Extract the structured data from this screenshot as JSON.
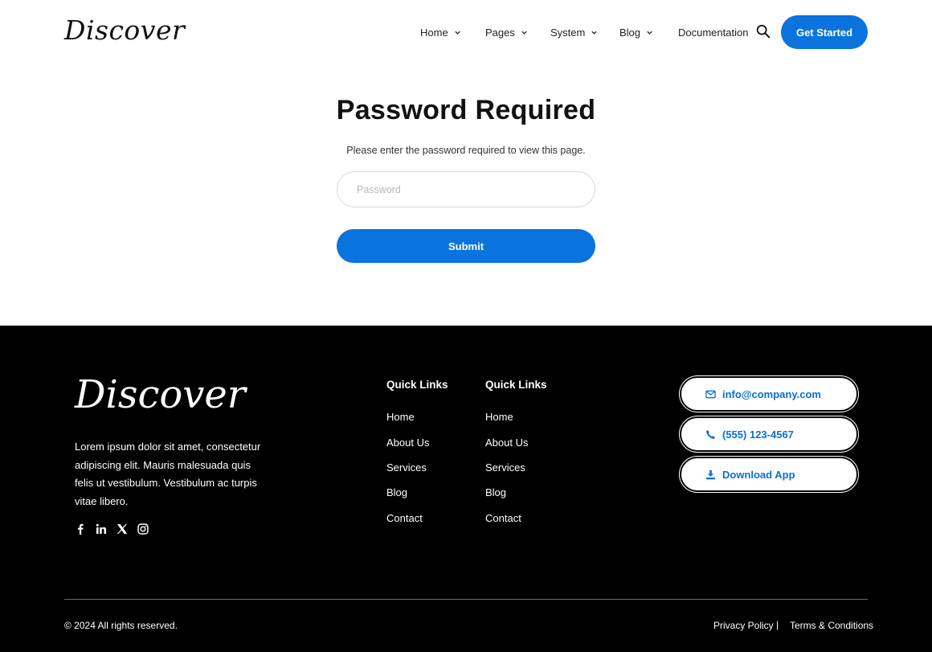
{
  "header": {
    "logo": "Discover",
    "nav": [
      {
        "label": "Home",
        "has_dropdown": true
      },
      {
        "label": "Pages",
        "has_dropdown": true
      },
      {
        "label": "System",
        "has_dropdown": true
      },
      {
        "label": "Blog",
        "has_dropdown": true
      },
      {
        "label": "Documentation",
        "has_dropdown": false
      }
    ],
    "search_icon": "search-icon",
    "cta_label": "Get Started"
  },
  "main": {
    "title": "Password Required",
    "description": "Please enter the password required to view this page.",
    "password_placeholder": "Password",
    "password_value": "",
    "submit_label": "Submit"
  },
  "footer": {
    "logo": "Discover",
    "description": "Lorem ipsum dolor sit amet, consectetur adipiscing elit. Mauris malesuada quis felis ut vestibulum. Vestibulum ac turpis vitae libero.",
    "social": [
      "facebook-icon",
      "linkedin-icon",
      "x-icon",
      "instagram-icon"
    ],
    "columns": [
      {
        "title": "Quick Links",
        "links": [
          "Home",
          "About Us",
          "Services",
          "Blog",
          "Contact"
        ]
      },
      {
        "title": "Quick Links",
        "links": [
          "Home",
          "About Us",
          "Services",
          "Blog",
          "Contact"
        ]
      }
    ],
    "contact": {
      "email": "info@company.com",
      "phone": "(555) 123-4567",
      "download": "Download App"
    },
    "copyright": "© 2024 All rights reserved.",
    "legal": {
      "privacy": "Privacy Policy",
      "separator": "|",
      "terms": "Terms & Conditions"
    }
  },
  "colors": {
    "accent": "#0a73dd",
    "footer_bg": "#000000",
    "text": "#1a1a1a"
  }
}
